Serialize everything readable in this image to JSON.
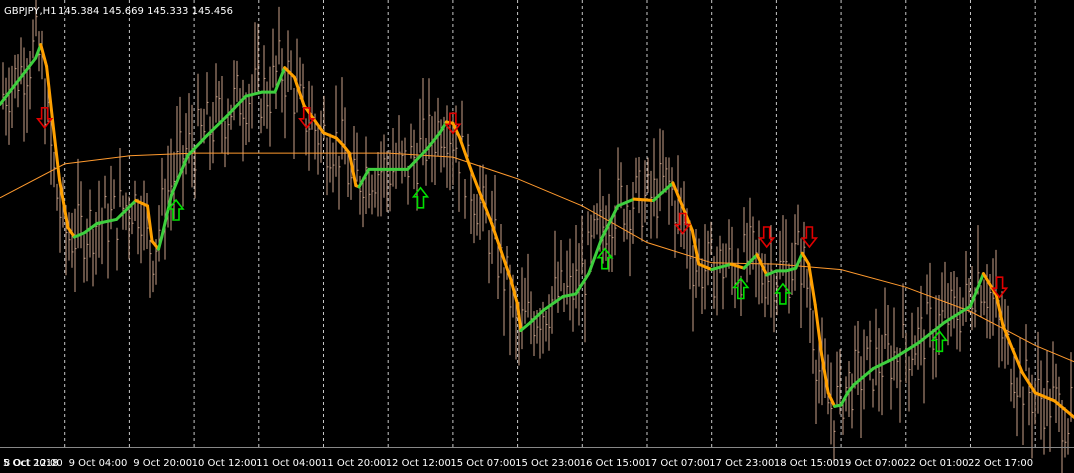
{
  "header": {
    "symbol": "GBPJPY,H1",
    "ohlc": "145.384 145.669 145.333 145.456"
  },
  "colors": {
    "background": "#000000",
    "candle": "#c9a189",
    "ma_slow": "#ff9a2e",
    "signal_up_trend": "#3ecf3e",
    "signal_down_trend": "#ffa000",
    "arrow_up": "#00e000",
    "arrow_down": "#e00000",
    "grid": "#c8c8c8",
    "text": "#ffffff"
  },
  "chart_data": {
    "type": "line",
    "title": "GBPJPY,H1",
    "x_tick_labels": [
      "5 Oct 2018",
      "8 Oct 12:00",
      "9 Oct 04:00",
      "9 Oct 20:00",
      "10 Oct 12:00",
      "11 Oct 04:00",
      "11 Oct 20:00",
      "12 Oct 12:00",
      "15 Oct 07:00",
      "15 Oct 23:00",
      "16 Oct 15:00",
      "17 Oct 07:00",
      "17 Oct 23:00",
      "18 Oct 15:00",
      "19 Oct 07:00",
      "22 Oct 01:00",
      "22 Oct 17:00"
    ],
    "x_range": [
      0,
      16.6
    ],
    "y_range": [
      144.2,
      147.5
    ],
    "grid": "vertical dashed",
    "series": [
      {
        "style": "thin orange line",
        "x": [
          0,
          1,
          2,
          3,
          4,
          5,
          6,
          7,
          8,
          9,
          10,
          11,
          12,
          13,
          14,
          15,
          16,
          16.6
        ],
        "y": [
          146.04,
          146.29,
          146.35,
          146.37,
          146.37,
          146.37,
          146.37,
          146.34,
          146.18,
          145.98,
          145.71,
          145.56,
          145.55,
          145.51,
          145.38,
          145.2,
          144.95,
          144.83
        ]
      },
      {
        "style": "thick green/orange line",
        "x": [
          0,
          0.55,
          0.63,
          0.72,
          0.82,
          0.92,
          1.05,
          1.15,
          1.3,
          1.5,
          1.8,
          2.1,
          2.28,
          2.35,
          2.45,
          2.5,
          2.65,
          2.9,
          3.2,
          3.5,
          3.8,
          4.05,
          4.25,
          4.4,
          4.55,
          4.7,
          5.0,
          5.2,
          5.3,
          5.4,
          5.5,
          5.55,
          5.7,
          6.0,
          6.3,
          6.6,
          6.8,
          6.9,
          7.0,
          7.1,
          7.3,
          7.6,
          7.9,
          8.0,
          8.05,
          8.2,
          8.4,
          8.7,
          8.9,
          9.1,
          9.3,
          9.55,
          9.8,
          10.1,
          10.4,
          10.7,
          10.8,
          11.0,
          11.3,
          11.5,
          11.7,
          11.85,
          12.0,
          12.15,
          12.3,
          12.4,
          12.5,
          12.6,
          12.7,
          12.8,
          12.9,
          13.0,
          13.1,
          13.2,
          13.5,
          13.8,
          14.2,
          14.6,
          15.0,
          15.2,
          15.4,
          15.5,
          15.6,
          15.8,
          16.0,
          16.3,
          16.6
        ],
        "y": [
          146.73,
          147.07,
          147.17,
          147.01,
          146.58,
          146.17,
          145.82,
          145.75,
          145.78,
          145.85,
          145.88,
          146.02,
          145.98,
          145.72,
          145.66,
          145.75,
          146.06,
          146.35,
          146.5,
          146.64,
          146.79,
          146.82,
          146.82,
          147.0,
          146.93,
          146.72,
          146.52,
          146.48,
          146.43,
          146.37,
          146.13,
          146.12,
          146.25,
          146.25,
          146.25,
          146.4,
          146.52,
          146.6,
          146.59,
          146.49,
          146.22,
          145.85,
          145.43,
          145.25,
          145.06,
          145.12,
          145.21,
          145.31,
          145.33,
          145.48,
          145.74,
          145.98,
          146.03,
          146.02,
          146.15,
          145.8,
          145.55,
          145.51,
          145.55,
          145.52,
          145.62,
          145.47,
          145.5,
          145.5,
          145.52,
          145.63,
          145.55,
          145.25,
          144.88,
          144.6,
          144.5,
          144.51,
          144.6,
          144.66,
          144.78,
          144.85,
          144.97,
          145.12,
          145.24,
          145.48,
          145.32,
          145.1,
          144.98,
          144.75,
          144.6,
          144.54,
          144.42
        ]
      }
    ],
    "signals": [
      {
        "x": 0.69,
        "y": 146.63,
        "dir": "down"
      },
      {
        "x": 2.72,
        "y": 145.95,
        "dir": "up"
      },
      {
        "x": 4.74,
        "y": 146.63,
        "dir": "down"
      },
      {
        "x": 6.5,
        "y": 146.04,
        "dir": "up"
      },
      {
        "x": 7.0,
        "y": 146.59,
        "dir": "down"
      },
      {
        "x": 9.35,
        "y": 145.59,
        "dir": "up"
      },
      {
        "x": 10.55,
        "y": 145.85,
        "dir": "down"
      },
      {
        "x": 11.45,
        "y": 145.37,
        "dir": "up"
      },
      {
        "x": 11.85,
        "y": 145.75,
        "dir": "down"
      },
      {
        "x": 12.1,
        "y": 145.33,
        "dir": "up"
      },
      {
        "x": 12.51,
        "y": 145.75,
        "dir": "down"
      },
      {
        "x": 14.52,
        "y": 144.98,
        "dir": "up"
      },
      {
        "x": 15.45,
        "y": 145.38,
        "dir": "down"
      }
    ]
  }
}
